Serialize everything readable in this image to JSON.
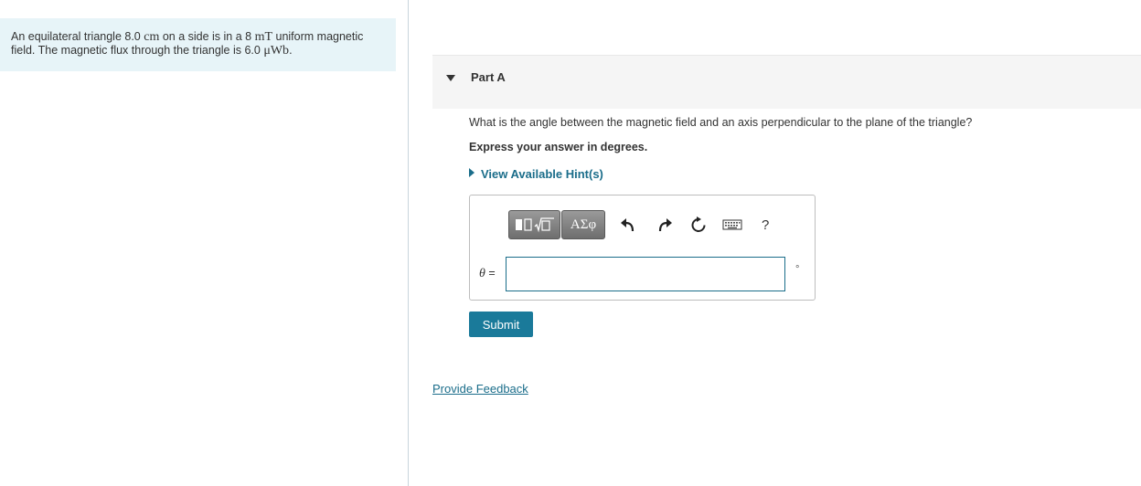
{
  "problem": {
    "text_1": "An equilateral triangle 8.0 ",
    "unit_cm": "cm",
    "text_2": " on a side is in a 8 ",
    "unit_mT": "mT",
    "text_3": " uniform magnetic field. The magnetic flux through the triangle is 6.0 ",
    "unit_uWb": "μWb",
    "text_4": "."
  },
  "part": {
    "title": "Part A"
  },
  "question": {
    "text": "What is the angle between the magnetic field and an axis perpendicular to the plane of the triangle?",
    "instruction": "Express your answer in degrees."
  },
  "hint": {
    "label": "View Available Hint(s)"
  },
  "toolbar": {
    "greek_label": "ΑΣφ",
    "help_label": "?",
    "icons": [
      "templates-icon",
      "undo-icon",
      "redo-icon",
      "reset-icon",
      "keyboard-icon",
      "help-icon"
    ]
  },
  "answer": {
    "variable": "θ",
    "equals": " =",
    "value": "",
    "unit": "°"
  },
  "submit": {
    "label": "Submit"
  },
  "feedback": {
    "label": "Provide Feedback"
  },
  "colors": {
    "accent": "#1a7a9a",
    "link": "#1a6d8a",
    "problem_bg": "#e7f4f8"
  }
}
